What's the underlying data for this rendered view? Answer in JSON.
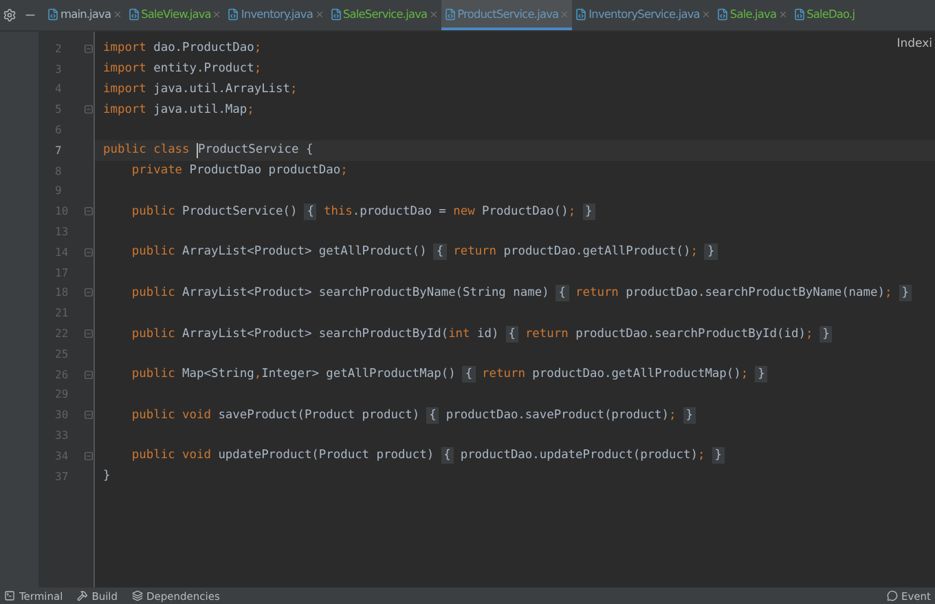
{
  "tabs": [
    {
      "label": "main.java",
      "selected": false,
      "color": "#a9b7c6"
    },
    {
      "label": "SaleView.java",
      "selected": false,
      "color": "#62b543"
    },
    {
      "label": "Inventory.java",
      "selected": false,
      "color": "#6897bb"
    },
    {
      "label": "SaleService.java",
      "selected": false,
      "color": "#62b543"
    },
    {
      "label": "ProductService.java",
      "selected": true,
      "color": "#6897bb"
    },
    {
      "label": "InventoryService.java",
      "selected": false,
      "color": "#6897bb"
    },
    {
      "label": "Sale.java",
      "selected": false,
      "color": "#62b543"
    },
    {
      "label": "SaleDao.j",
      "selected": false,
      "color": "#62b543"
    }
  ],
  "notice": "Indexi",
  "lines": [
    {
      "number": "2",
      "current": false,
      "fold": true,
      "segments": [
        {
          "text": "import",
          "kind": "keyword"
        },
        {
          "text": " dao.ProductDao",
          "kind": "plain"
        },
        {
          "text": ";",
          "kind": "keyword"
        }
      ]
    },
    {
      "number": "3",
      "current": false,
      "fold": false,
      "segments": [
        {
          "text": "import",
          "kind": "keyword"
        },
        {
          "text": " entity.Product",
          "kind": "plain"
        },
        {
          "text": ";",
          "kind": "keyword"
        }
      ]
    },
    {
      "number": "4",
      "current": false,
      "fold": false,
      "segments": [
        {
          "text": "import",
          "kind": "keyword"
        },
        {
          "text": " java.util.ArrayList",
          "kind": "plain"
        },
        {
          "text": ";",
          "kind": "keyword"
        }
      ]
    },
    {
      "number": "5",
      "current": false,
      "fold": true,
      "segments": [
        {
          "text": "import",
          "kind": "keyword"
        },
        {
          "text": " java.util.Map",
          "kind": "plain"
        },
        {
          "text": ";",
          "kind": "keyword"
        }
      ]
    },
    {
      "number": "6",
      "current": false,
      "fold": false
    },
    {
      "number": "7",
      "current": true,
      "fold": false,
      "segments": [
        {
          "text": "public class ",
          "kind": "keyword"
        },
        {
          "text": "ProductService {",
          "kind": "plain"
        }
      ]
    },
    {
      "number": "8",
      "current": false,
      "fold": false,
      "segments": [
        {
          "text": "    private ",
          "kind": "keyword"
        },
        {
          "text": "ProductDao productDao",
          "kind": "plain"
        },
        {
          "text": ";",
          "kind": "keyword"
        }
      ]
    },
    {
      "number": "9",
      "current": false,
      "fold": false
    },
    {
      "number": "10",
      "current": false,
      "fold": true,
      "segments": [
        {
          "text": "    public ",
          "kind": "keyword"
        },
        {
          "text": "ProductService()",
          "kind": "plain"
        },
        {
          "text": "{",
          "kind": "folded"
        },
        {
          "text": "this",
          "kind": "keyword"
        },
        {
          "text": ".productDao = ",
          "kind": "plain"
        },
        {
          "text": "new ",
          "kind": "keyword"
        },
        {
          "text": "ProductDao()",
          "kind": "plain"
        },
        {
          "text": ";",
          "kind": "keyword"
        },
        {
          "text": "}",
          "kind": "folded"
        }
      ]
    },
    {
      "number": "13",
      "current": false,
      "fold": false
    },
    {
      "number": "14",
      "current": false,
      "fold": true,
      "segments": [
        {
          "text": "    public ",
          "kind": "keyword"
        },
        {
          "text": "ArrayList<Product> getAllProduct()",
          "kind": "plain"
        },
        {
          "text": "{",
          "kind": "folded"
        },
        {
          "text": "return ",
          "kind": "keyword"
        },
        {
          "text": "productDao.getAllProduct()",
          "kind": "plain"
        },
        {
          "text": ";",
          "kind": "keyword"
        },
        {
          "text": "}",
          "kind": "folded"
        }
      ]
    },
    {
      "number": "17",
      "current": false,
      "fold": false
    },
    {
      "number": "18",
      "current": false,
      "fold": true,
      "segments": [
        {
          "text": "    public ",
          "kind": "keyword"
        },
        {
          "text": "ArrayList<Product> searchProductByName(String name)",
          "kind": "plain"
        },
        {
          "text": "{",
          "kind": "folded"
        },
        {
          "text": "return ",
          "kind": "keyword"
        },
        {
          "text": "productDao.searchProductByName(name)",
          "kind": "plain"
        },
        {
          "text": ";",
          "kind": "keyword"
        },
        {
          "text": "}",
          "kind": "folded"
        }
      ]
    },
    {
      "number": "21",
      "current": false,
      "fold": false
    },
    {
      "number": "22",
      "current": false,
      "fold": true,
      "segments": [
        {
          "text": "    public ",
          "kind": "keyword"
        },
        {
          "text": "ArrayList<Product> searchProductById(",
          "kind": "plain"
        },
        {
          "text": "int ",
          "kind": "keyword"
        },
        {
          "text": "id)",
          "kind": "plain"
        },
        {
          "text": "{",
          "kind": "folded"
        },
        {
          "text": "return ",
          "kind": "keyword"
        },
        {
          "text": "productDao.searchProductById(id)",
          "kind": "plain"
        },
        {
          "text": ";",
          "kind": "keyword"
        },
        {
          "text": "}",
          "kind": "folded"
        }
      ]
    },
    {
      "number": "25",
      "current": false,
      "fold": false
    },
    {
      "number": "26",
      "current": false,
      "fold": true,
      "segments": [
        {
          "text": "    public ",
          "kind": "keyword"
        },
        {
          "text": "Map<String",
          "kind": "plain"
        },
        {
          "text": ",",
          "kind": "keyword"
        },
        {
          "text": "Integer> getAllProductMap()",
          "kind": "plain"
        },
        {
          "text": "{",
          "kind": "folded"
        },
        {
          "text": "return ",
          "kind": "keyword"
        },
        {
          "text": "productDao.getAllProductMap()",
          "kind": "plain"
        },
        {
          "text": ";",
          "kind": "keyword"
        },
        {
          "text": "}",
          "kind": "folded"
        }
      ]
    },
    {
      "number": "29",
      "current": false,
      "fold": false
    },
    {
      "number": "30",
      "current": false,
      "fold": true,
      "segments": [
        {
          "text": "    public void ",
          "kind": "keyword"
        },
        {
          "text": "saveProduct(Product product)",
          "kind": "plain"
        },
        {
          "text": "{",
          "kind": "folded"
        },
        {
          "text": "productDao.saveProduct(product)",
          "kind": "plain"
        },
        {
          "text": ";",
          "kind": "keyword"
        },
        {
          "text": "}",
          "kind": "folded"
        }
      ]
    },
    {
      "number": "33",
      "current": false,
      "fold": false
    },
    {
      "number": "34",
      "current": false,
      "fold": true,
      "segments": [
        {
          "text": "    public void ",
          "kind": "keyword"
        },
        {
          "text": "updateProduct(Product product)",
          "kind": "plain"
        },
        {
          "text": "{",
          "kind": "folded"
        },
        {
          "text": "productDao.updateProduct(product)",
          "kind": "plain"
        },
        {
          "text": ";",
          "kind": "keyword"
        },
        {
          "text": "}",
          "kind": "folded"
        }
      ]
    },
    {
      "number": "37",
      "current": false,
      "fold": false,
      "segments": [
        {
          "text": "}",
          "kind": "plain"
        }
      ]
    }
  ],
  "tool_windows": [
    "Terminal",
    "Build",
    "Dependencies"
  ],
  "status_right": "Event"
}
